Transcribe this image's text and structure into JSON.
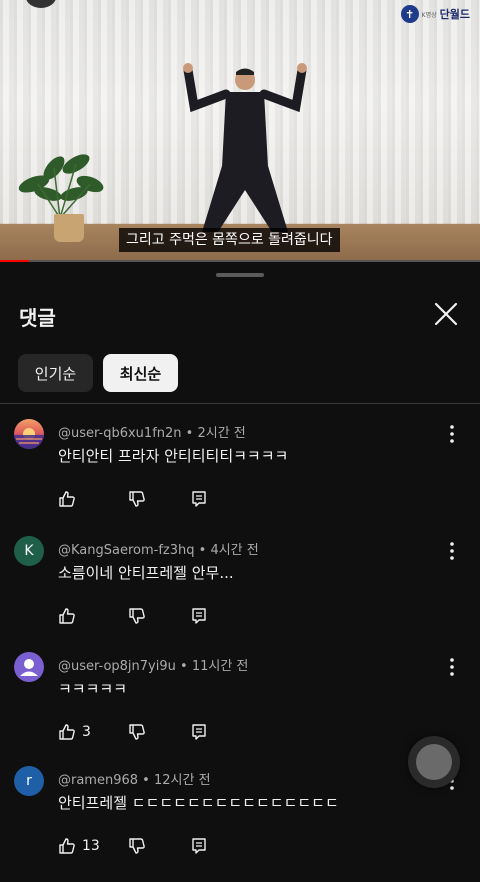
{
  "video": {
    "subtitle": "그리고 주먹은 몸쪽으로 돌려줍니다",
    "logo_text": "단월드",
    "logo_small": "K명상",
    "progress": 0.06
  },
  "comments_sheet": {
    "title": "댓글",
    "sort_chips": [
      {
        "label": "인기순",
        "selected": false
      },
      {
        "label": "최신순",
        "selected": true
      }
    ],
    "comments": [
      {
        "author": "@user-qb6xu1fn2n",
        "time": "2시간 전",
        "text": "안티안티 프라자 안티티티티ㅋㅋㅋㅋ",
        "likes": "",
        "avatar_letter": "",
        "avatar_color": "#d96b5a"
      },
      {
        "author": "@KangSaerom-fz3hq",
        "time": "4시간 전",
        "text": "소름이네 안티프레젤 안무...",
        "likes": "",
        "avatar_letter": "K",
        "avatar_color": "#1f5f4a"
      },
      {
        "author": "@user-op8jn7yi9u",
        "time": "11시간 전",
        "text": "ㅋㅋㅋㅋㅋ",
        "likes": "3",
        "avatar_letter": "",
        "avatar_color": "#7a5fd0"
      },
      {
        "author": "@ramen968",
        "time": "12시간 전",
        "text": "안티프레젤 ㄷㄷㄷㄷㄷㄷㄷㄷㄷㄷㄷㄷㄷㄷㄷ",
        "likes": "13",
        "avatar_letter": "r",
        "avatar_color": "#1e5fa8"
      }
    ],
    "separator": " • "
  },
  "icons": {
    "close": "close-icon",
    "like": "thumbs-up-icon",
    "dislike": "thumbs-down-icon",
    "reply": "reply-icon",
    "more": "more-vertical-icon"
  }
}
